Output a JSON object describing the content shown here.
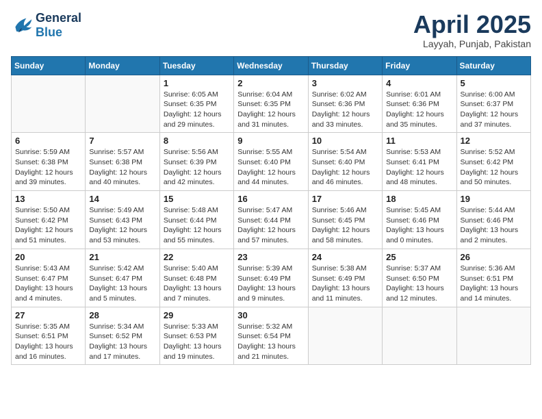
{
  "header": {
    "logo_line1": "General",
    "logo_line2": "Blue",
    "month_title": "April 2025",
    "location": "Layyah, Punjab, Pakistan"
  },
  "weekdays": [
    "Sunday",
    "Monday",
    "Tuesday",
    "Wednesday",
    "Thursday",
    "Friday",
    "Saturday"
  ],
  "weeks": [
    [
      {
        "day": "",
        "sunrise": "",
        "sunset": "",
        "daylight": ""
      },
      {
        "day": "",
        "sunrise": "",
        "sunset": "",
        "daylight": ""
      },
      {
        "day": "1",
        "sunrise": "Sunrise: 6:05 AM",
        "sunset": "Sunset: 6:35 PM",
        "daylight": "Daylight: 12 hours and 29 minutes."
      },
      {
        "day": "2",
        "sunrise": "Sunrise: 6:04 AM",
        "sunset": "Sunset: 6:35 PM",
        "daylight": "Daylight: 12 hours and 31 minutes."
      },
      {
        "day": "3",
        "sunrise": "Sunrise: 6:02 AM",
        "sunset": "Sunset: 6:36 PM",
        "daylight": "Daylight: 12 hours and 33 minutes."
      },
      {
        "day": "4",
        "sunrise": "Sunrise: 6:01 AM",
        "sunset": "Sunset: 6:36 PM",
        "daylight": "Daylight: 12 hours and 35 minutes."
      },
      {
        "day": "5",
        "sunrise": "Sunrise: 6:00 AM",
        "sunset": "Sunset: 6:37 PM",
        "daylight": "Daylight: 12 hours and 37 minutes."
      }
    ],
    [
      {
        "day": "6",
        "sunrise": "Sunrise: 5:59 AM",
        "sunset": "Sunset: 6:38 PM",
        "daylight": "Daylight: 12 hours and 39 minutes."
      },
      {
        "day": "7",
        "sunrise": "Sunrise: 5:57 AM",
        "sunset": "Sunset: 6:38 PM",
        "daylight": "Daylight: 12 hours and 40 minutes."
      },
      {
        "day": "8",
        "sunrise": "Sunrise: 5:56 AM",
        "sunset": "Sunset: 6:39 PM",
        "daylight": "Daylight: 12 hours and 42 minutes."
      },
      {
        "day": "9",
        "sunrise": "Sunrise: 5:55 AM",
        "sunset": "Sunset: 6:40 PM",
        "daylight": "Daylight: 12 hours and 44 minutes."
      },
      {
        "day": "10",
        "sunrise": "Sunrise: 5:54 AM",
        "sunset": "Sunset: 6:40 PM",
        "daylight": "Daylight: 12 hours and 46 minutes."
      },
      {
        "day": "11",
        "sunrise": "Sunrise: 5:53 AM",
        "sunset": "Sunset: 6:41 PM",
        "daylight": "Daylight: 12 hours and 48 minutes."
      },
      {
        "day": "12",
        "sunrise": "Sunrise: 5:52 AM",
        "sunset": "Sunset: 6:42 PM",
        "daylight": "Daylight: 12 hours and 50 minutes."
      }
    ],
    [
      {
        "day": "13",
        "sunrise": "Sunrise: 5:50 AM",
        "sunset": "Sunset: 6:42 PM",
        "daylight": "Daylight: 12 hours and 51 minutes."
      },
      {
        "day": "14",
        "sunrise": "Sunrise: 5:49 AM",
        "sunset": "Sunset: 6:43 PM",
        "daylight": "Daylight: 12 hours and 53 minutes."
      },
      {
        "day": "15",
        "sunrise": "Sunrise: 5:48 AM",
        "sunset": "Sunset: 6:44 PM",
        "daylight": "Daylight: 12 hours and 55 minutes."
      },
      {
        "day": "16",
        "sunrise": "Sunrise: 5:47 AM",
        "sunset": "Sunset: 6:44 PM",
        "daylight": "Daylight: 12 hours and 57 minutes."
      },
      {
        "day": "17",
        "sunrise": "Sunrise: 5:46 AM",
        "sunset": "Sunset: 6:45 PM",
        "daylight": "Daylight: 12 hours and 58 minutes."
      },
      {
        "day": "18",
        "sunrise": "Sunrise: 5:45 AM",
        "sunset": "Sunset: 6:46 PM",
        "daylight": "Daylight: 13 hours and 0 minutes."
      },
      {
        "day": "19",
        "sunrise": "Sunrise: 5:44 AM",
        "sunset": "Sunset: 6:46 PM",
        "daylight": "Daylight: 13 hours and 2 minutes."
      }
    ],
    [
      {
        "day": "20",
        "sunrise": "Sunrise: 5:43 AM",
        "sunset": "Sunset: 6:47 PM",
        "daylight": "Daylight: 13 hours and 4 minutes."
      },
      {
        "day": "21",
        "sunrise": "Sunrise: 5:42 AM",
        "sunset": "Sunset: 6:47 PM",
        "daylight": "Daylight: 13 hours and 5 minutes."
      },
      {
        "day": "22",
        "sunrise": "Sunrise: 5:40 AM",
        "sunset": "Sunset: 6:48 PM",
        "daylight": "Daylight: 13 hours and 7 minutes."
      },
      {
        "day": "23",
        "sunrise": "Sunrise: 5:39 AM",
        "sunset": "Sunset: 6:49 PM",
        "daylight": "Daylight: 13 hours and 9 minutes."
      },
      {
        "day": "24",
        "sunrise": "Sunrise: 5:38 AM",
        "sunset": "Sunset: 6:49 PM",
        "daylight": "Daylight: 13 hours and 11 minutes."
      },
      {
        "day": "25",
        "sunrise": "Sunrise: 5:37 AM",
        "sunset": "Sunset: 6:50 PM",
        "daylight": "Daylight: 13 hours and 12 minutes."
      },
      {
        "day": "26",
        "sunrise": "Sunrise: 5:36 AM",
        "sunset": "Sunset: 6:51 PM",
        "daylight": "Daylight: 13 hours and 14 minutes."
      }
    ],
    [
      {
        "day": "27",
        "sunrise": "Sunrise: 5:35 AM",
        "sunset": "Sunset: 6:51 PM",
        "daylight": "Daylight: 13 hours and 16 minutes."
      },
      {
        "day": "28",
        "sunrise": "Sunrise: 5:34 AM",
        "sunset": "Sunset: 6:52 PM",
        "daylight": "Daylight: 13 hours and 17 minutes."
      },
      {
        "day": "29",
        "sunrise": "Sunrise: 5:33 AM",
        "sunset": "Sunset: 6:53 PM",
        "daylight": "Daylight: 13 hours and 19 minutes."
      },
      {
        "day": "30",
        "sunrise": "Sunrise: 5:32 AM",
        "sunset": "Sunset: 6:54 PM",
        "daylight": "Daylight: 13 hours and 21 minutes."
      },
      {
        "day": "",
        "sunrise": "",
        "sunset": "",
        "daylight": ""
      },
      {
        "day": "",
        "sunrise": "",
        "sunset": "",
        "daylight": ""
      },
      {
        "day": "",
        "sunrise": "",
        "sunset": "",
        "daylight": ""
      }
    ]
  ]
}
